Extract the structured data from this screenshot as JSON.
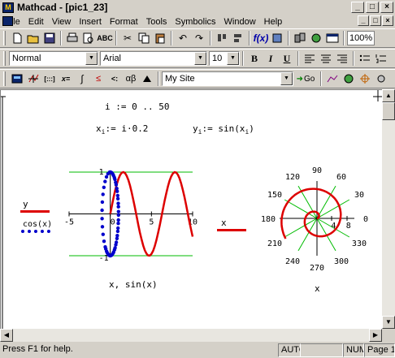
{
  "window": {
    "title": "Mathcad - [pic1_23]",
    "app_icon": "mathcad-icon"
  },
  "menu": [
    "File",
    "Edit",
    "View",
    "Insert",
    "Format",
    "Tools",
    "Symbolics",
    "Window",
    "Help"
  ],
  "toolbar2": {
    "style": "Normal",
    "font": "Arial",
    "size": "10",
    "bold": "B",
    "italic": "I",
    "underline": "U"
  },
  "toolbar1": {
    "zoom": "100%"
  },
  "toolbar3": {
    "site": "My Site",
    "go": "Go"
  },
  "doc": {
    "range_def": "i := 0 .. 50",
    "x_def": "x",
    "x_sub": "i",
    "x_rhs": ":= i·0.2",
    "y_def": "y",
    "y_sub": "i",
    "y_rhs": ":= sin(x",
    "y_rhs_sub": "i",
    "y_rhs_end": ")"
  },
  "chart_data": [
    {
      "type": "line",
      "legend": [
        {
          "name": "y",
          "color": "#dd0000",
          "style": "solid"
        },
        {
          "name": "cos(x)",
          "color": "#0000cc",
          "style": "dotted"
        }
      ],
      "xlabel": "x, sin(x)",
      "xlim": [
        -5,
        10
      ],
      "ylim": [
        -1,
        1
      ],
      "x_ticks": [
        "-5",
        "0",
        "5",
        "10"
      ],
      "y_ticks": [
        "1",
        "-1"
      ],
      "series": [
        {
          "name": "y",
          "x_from": 0,
          "x_to": 10,
          "points": 51,
          "function": "sin"
        },
        {
          "name": "cos(x)",
          "x_from": 0,
          "x_to": 10,
          "points": 51,
          "function": "cos_vs_sin"
        }
      ]
    },
    {
      "type": "polar",
      "legend": [
        {
          "name": "x",
          "color": "#dd0000"
        }
      ],
      "xlabel": "x",
      "angle_ticks": [
        "90",
        "120",
        "60",
        "150",
        "30",
        "180",
        "0",
        "210",
        "330",
        "240",
        "300",
        "270"
      ],
      "radial_ticks": [
        "4",
        "8"
      ],
      "r_max": 10
    }
  ],
  "status": {
    "help": "Press F1 for help.",
    "mode": "AUTO",
    "num": "NUM",
    "page": "Page 1"
  }
}
